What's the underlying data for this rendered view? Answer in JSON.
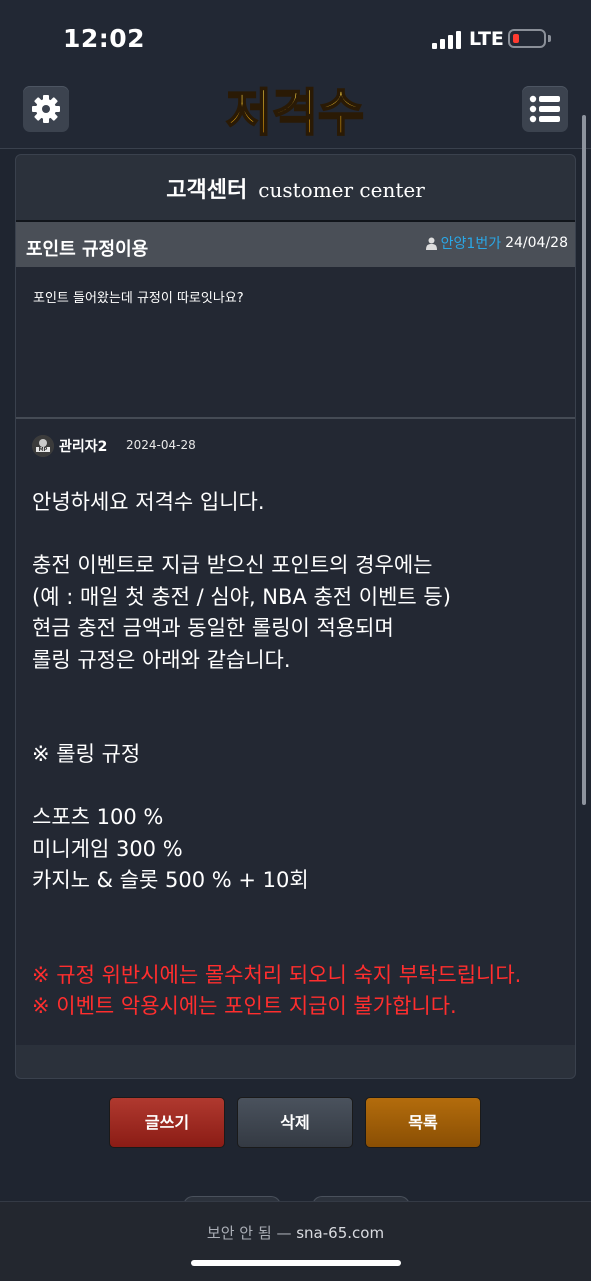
{
  "status": {
    "time": "12:02",
    "network": "LTE",
    "battery_color": "#ff3b30"
  },
  "header": {
    "logo_text": "저격수",
    "settings_icon": "gear-icon",
    "menu_icon": "list-menu-icon"
  },
  "panel": {
    "title_ko": "고객센터",
    "title_en": "customer center"
  },
  "post": {
    "title": "포인트 규정이용",
    "author": "안양1번가",
    "date": "24/04/28",
    "body": "포인트 들어왔는데 규정이 따로잇나요?"
  },
  "reply": {
    "author": "관리자2",
    "date": "2024-04-28",
    "lines": [
      "안녕하세요 저격수 입니다.",
      "",
      "충전 이벤트로 지급 받으신 포인트의 경우에는",
      "(예 : 매일 첫 충전 / 심야, NBA 충전 이벤트 등)",
      "현금 충전 금액과 동일한 롤링이 적용되며",
      "롤링 규정은 아래와 같습니다.",
      "",
      "",
      "※ 롤링 규정",
      "",
      "스포츠 100 %",
      "미니게임 300 %",
      "카지노 & 슬롯 500 % + 10회",
      "",
      ""
    ],
    "warnings": [
      "※ 규정 위반시에는 몰수처리 되오니 숙지 부탁드립니다.",
      "※ 이벤트 악용시에는 포인트 지급이 불가합니다."
    ],
    "warning_color": "#ff2e2e"
  },
  "buttons": {
    "write": "글쓰기",
    "delete": "삭제",
    "list": "목록"
  },
  "browser": {
    "security": "보안 안 됨",
    "separator": "—",
    "domain": "sna-65.com"
  }
}
